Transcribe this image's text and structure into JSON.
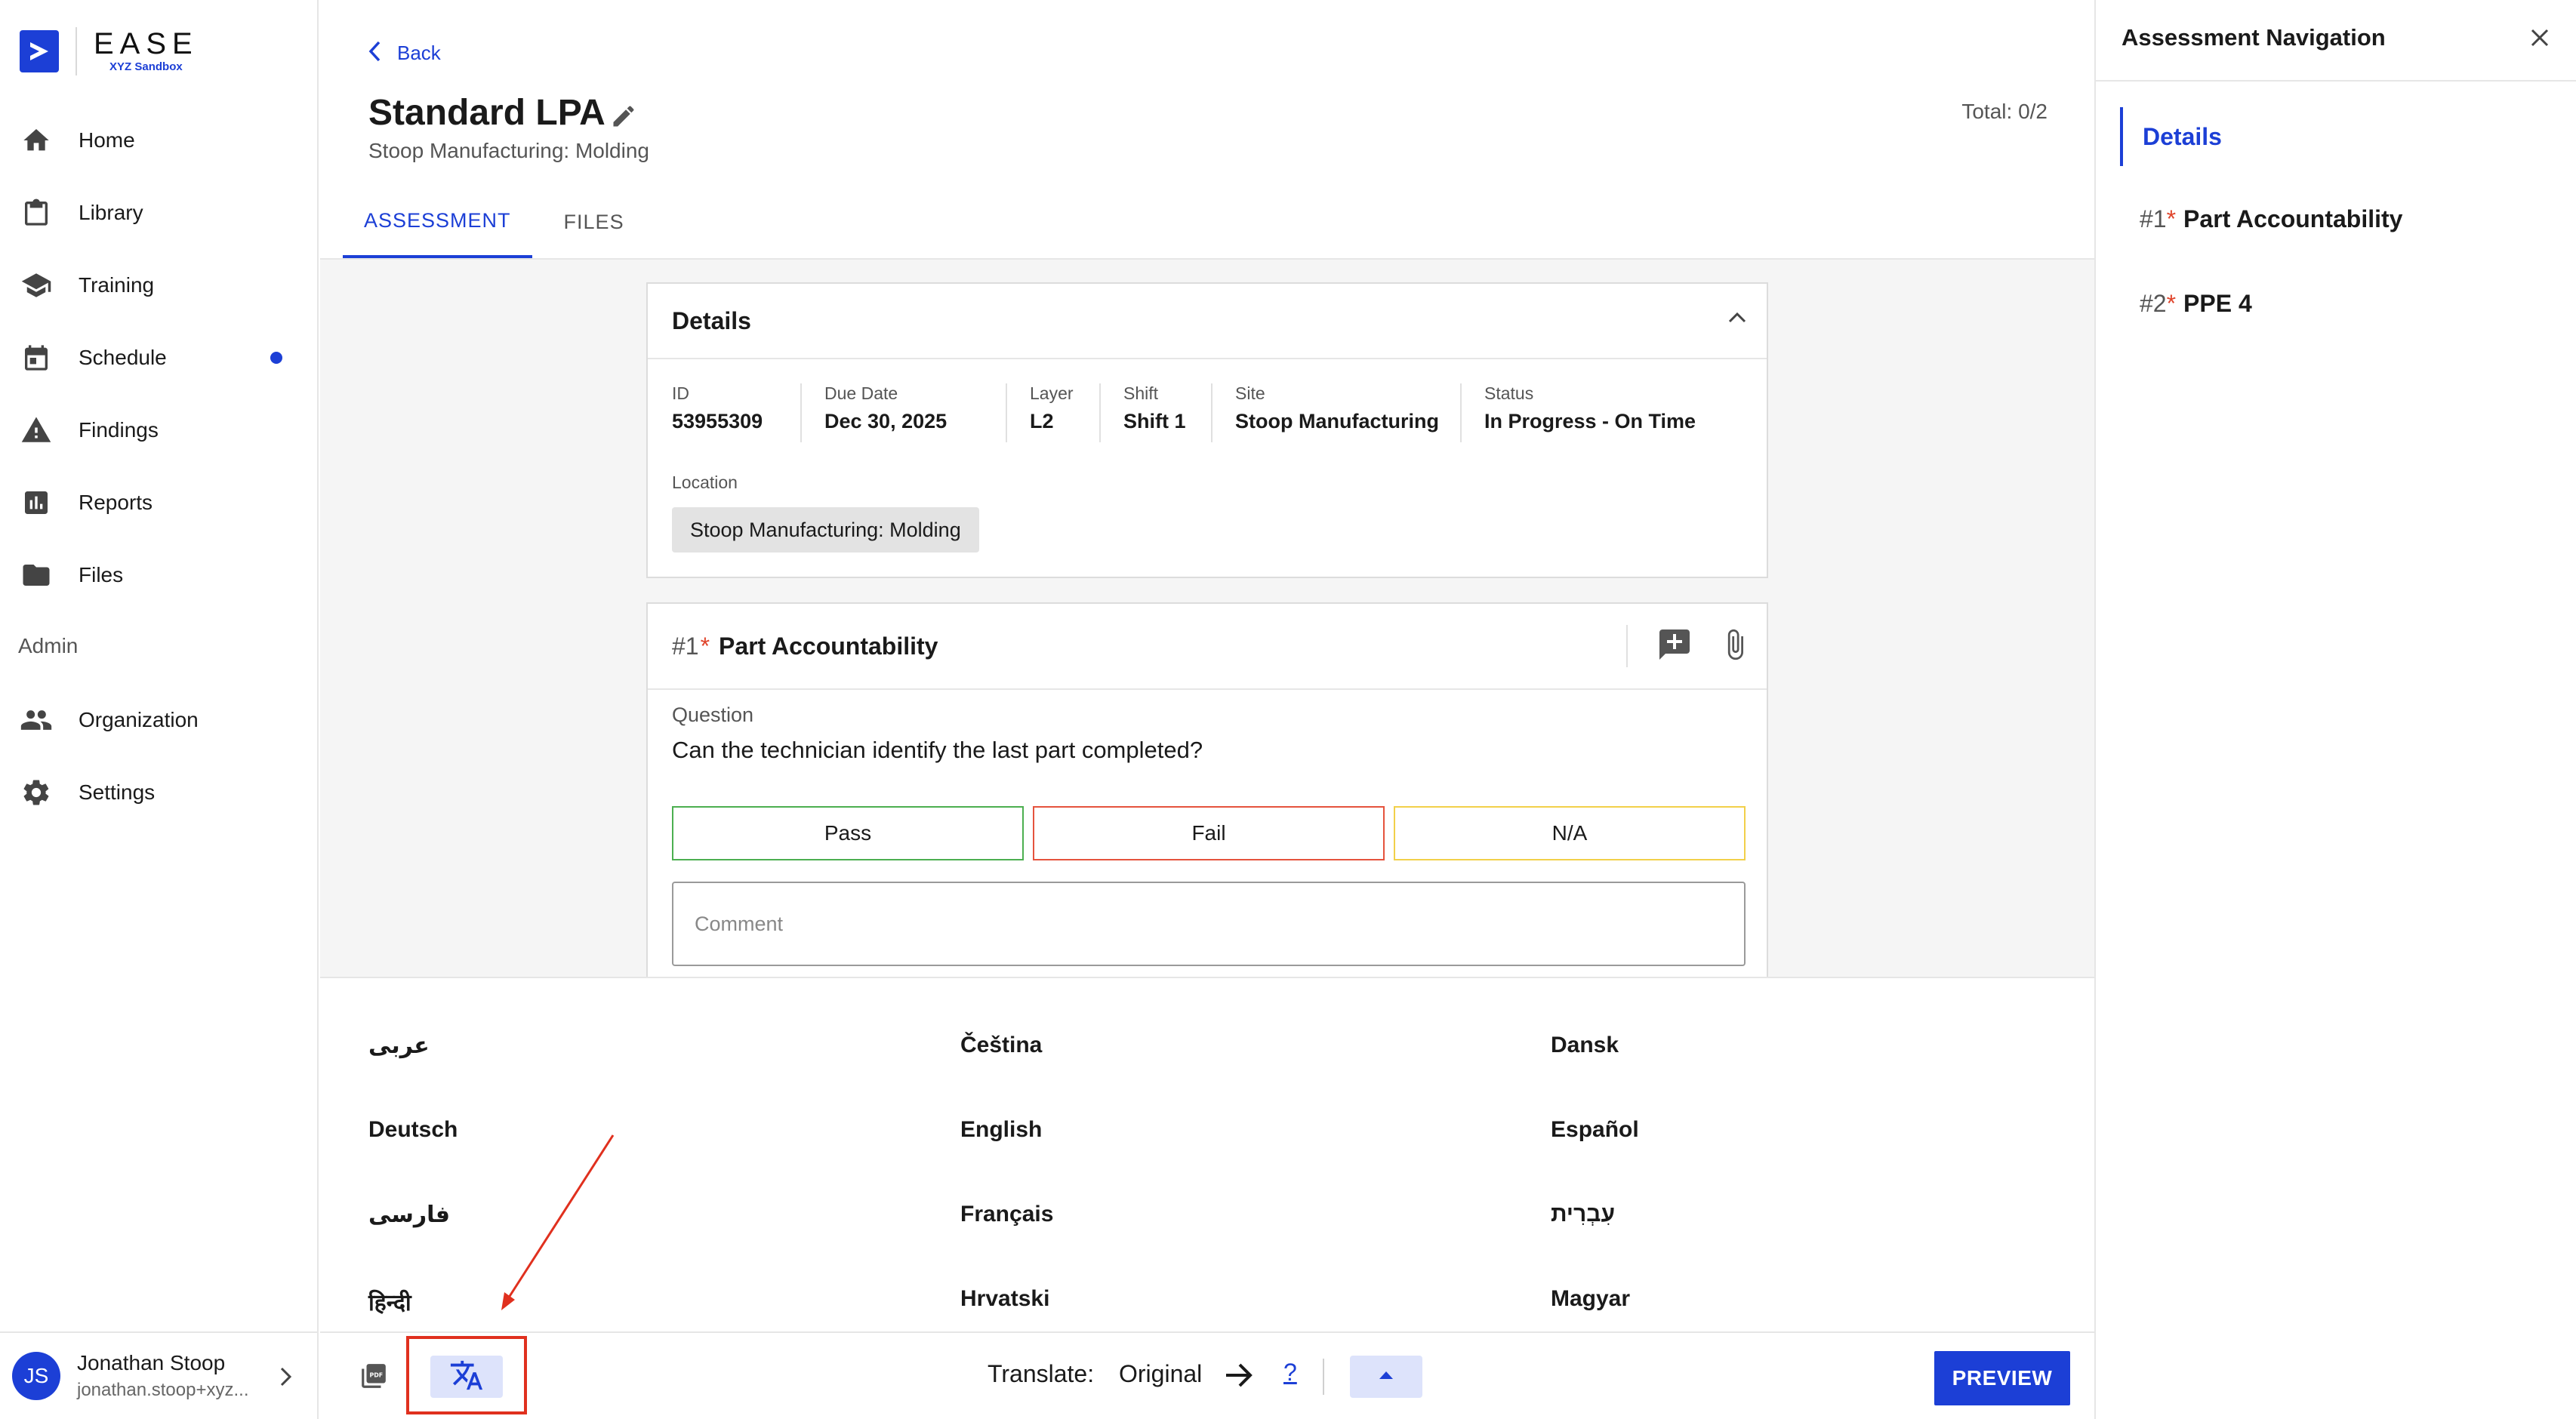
{
  "brand": {
    "name": "EASE",
    "env": "XYZ Sandbox",
    "colors": {
      "primary": "#1c3fd6",
      "pass": "#4caf50",
      "fail": "#e5533d",
      "na": "#f2d04a",
      "required": "#e0452c",
      "annotation": "#e0301e"
    }
  },
  "sidebar": {
    "items": [
      {
        "label": "Home",
        "icon": "home-icon"
      },
      {
        "label": "Library",
        "icon": "clipboard-icon"
      },
      {
        "label": "Training",
        "icon": "graduation-cap-icon"
      },
      {
        "label": "Schedule",
        "icon": "calendar-icon",
        "has_notification": true
      },
      {
        "label": "Findings",
        "icon": "warning-icon"
      },
      {
        "label": "Reports",
        "icon": "bar-chart-icon"
      },
      {
        "label": "Files",
        "icon": "folder-icon"
      }
    ],
    "admin_label": "Admin",
    "admin_items": [
      {
        "label": "Organization",
        "icon": "people-icon"
      },
      {
        "label": "Settings",
        "icon": "gear-icon"
      }
    ],
    "user": {
      "initials": "JS",
      "name": "Jonathan Stoop",
      "email": "jonathan.stoop+xyz..."
    }
  },
  "header": {
    "back_label": "Back",
    "title": "Standard LPA",
    "subtitle": "Stoop Manufacturing: Molding",
    "total": "Total: 0/2"
  },
  "tabs": [
    {
      "label": "ASSESSMENT",
      "active": true
    },
    {
      "label": "FILES",
      "active": false
    }
  ],
  "details": {
    "title": "Details",
    "fields": [
      {
        "label": "ID",
        "value": "53955309"
      },
      {
        "label": "Due Date",
        "value": "Dec 30, 2025"
      },
      {
        "label": "Layer",
        "value": "L2"
      },
      {
        "label": "Shift",
        "value": "Shift 1"
      },
      {
        "label": "Site",
        "value": "Stoop Manufacturing"
      },
      {
        "label": "Status",
        "value": "In Progress - On Time"
      }
    ],
    "location_label": "Location",
    "location_value": "Stoop Manufacturing: Molding"
  },
  "question": {
    "number": "#1",
    "required_mark": "*",
    "title": "Part Accountability",
    "question_label": "Question",
    "question_text": "Can the technician identify the last part completed?",
    "answers": {
      "pass": "Pass",
      "fail": "Fail",
      "na": "N/A"
    },
    "comment_placeholder": "Comment"
  },
  "languages": [
    "عربى",
    "Čeština",
    "Dansk",
    "Deutsch",
    "English",
    "Español",
    "فارسی",
    "Français",
    "עִבְרִית",
    "हिन्दी",
    "Hrvatski",
    "Magyar"
  ],
  "toolbar": {
    "translate_label": "Translate:",
    "translate_source": "Original",
    "translate_target": "?",
    "preview_label": "PREVIEW"
  },
  "assessment_nav": {
    "title": "Assessment Navigation",
    "details_label": "Details",
    "items": [
      {
        "number": "#1",
        "required_mark": "*",
        "name": "Part Accountability"
      },
      {
        "number": "#2",
        "required_mark": "*",
        "name": "PPE 4"
      }
    ]
  }
}
